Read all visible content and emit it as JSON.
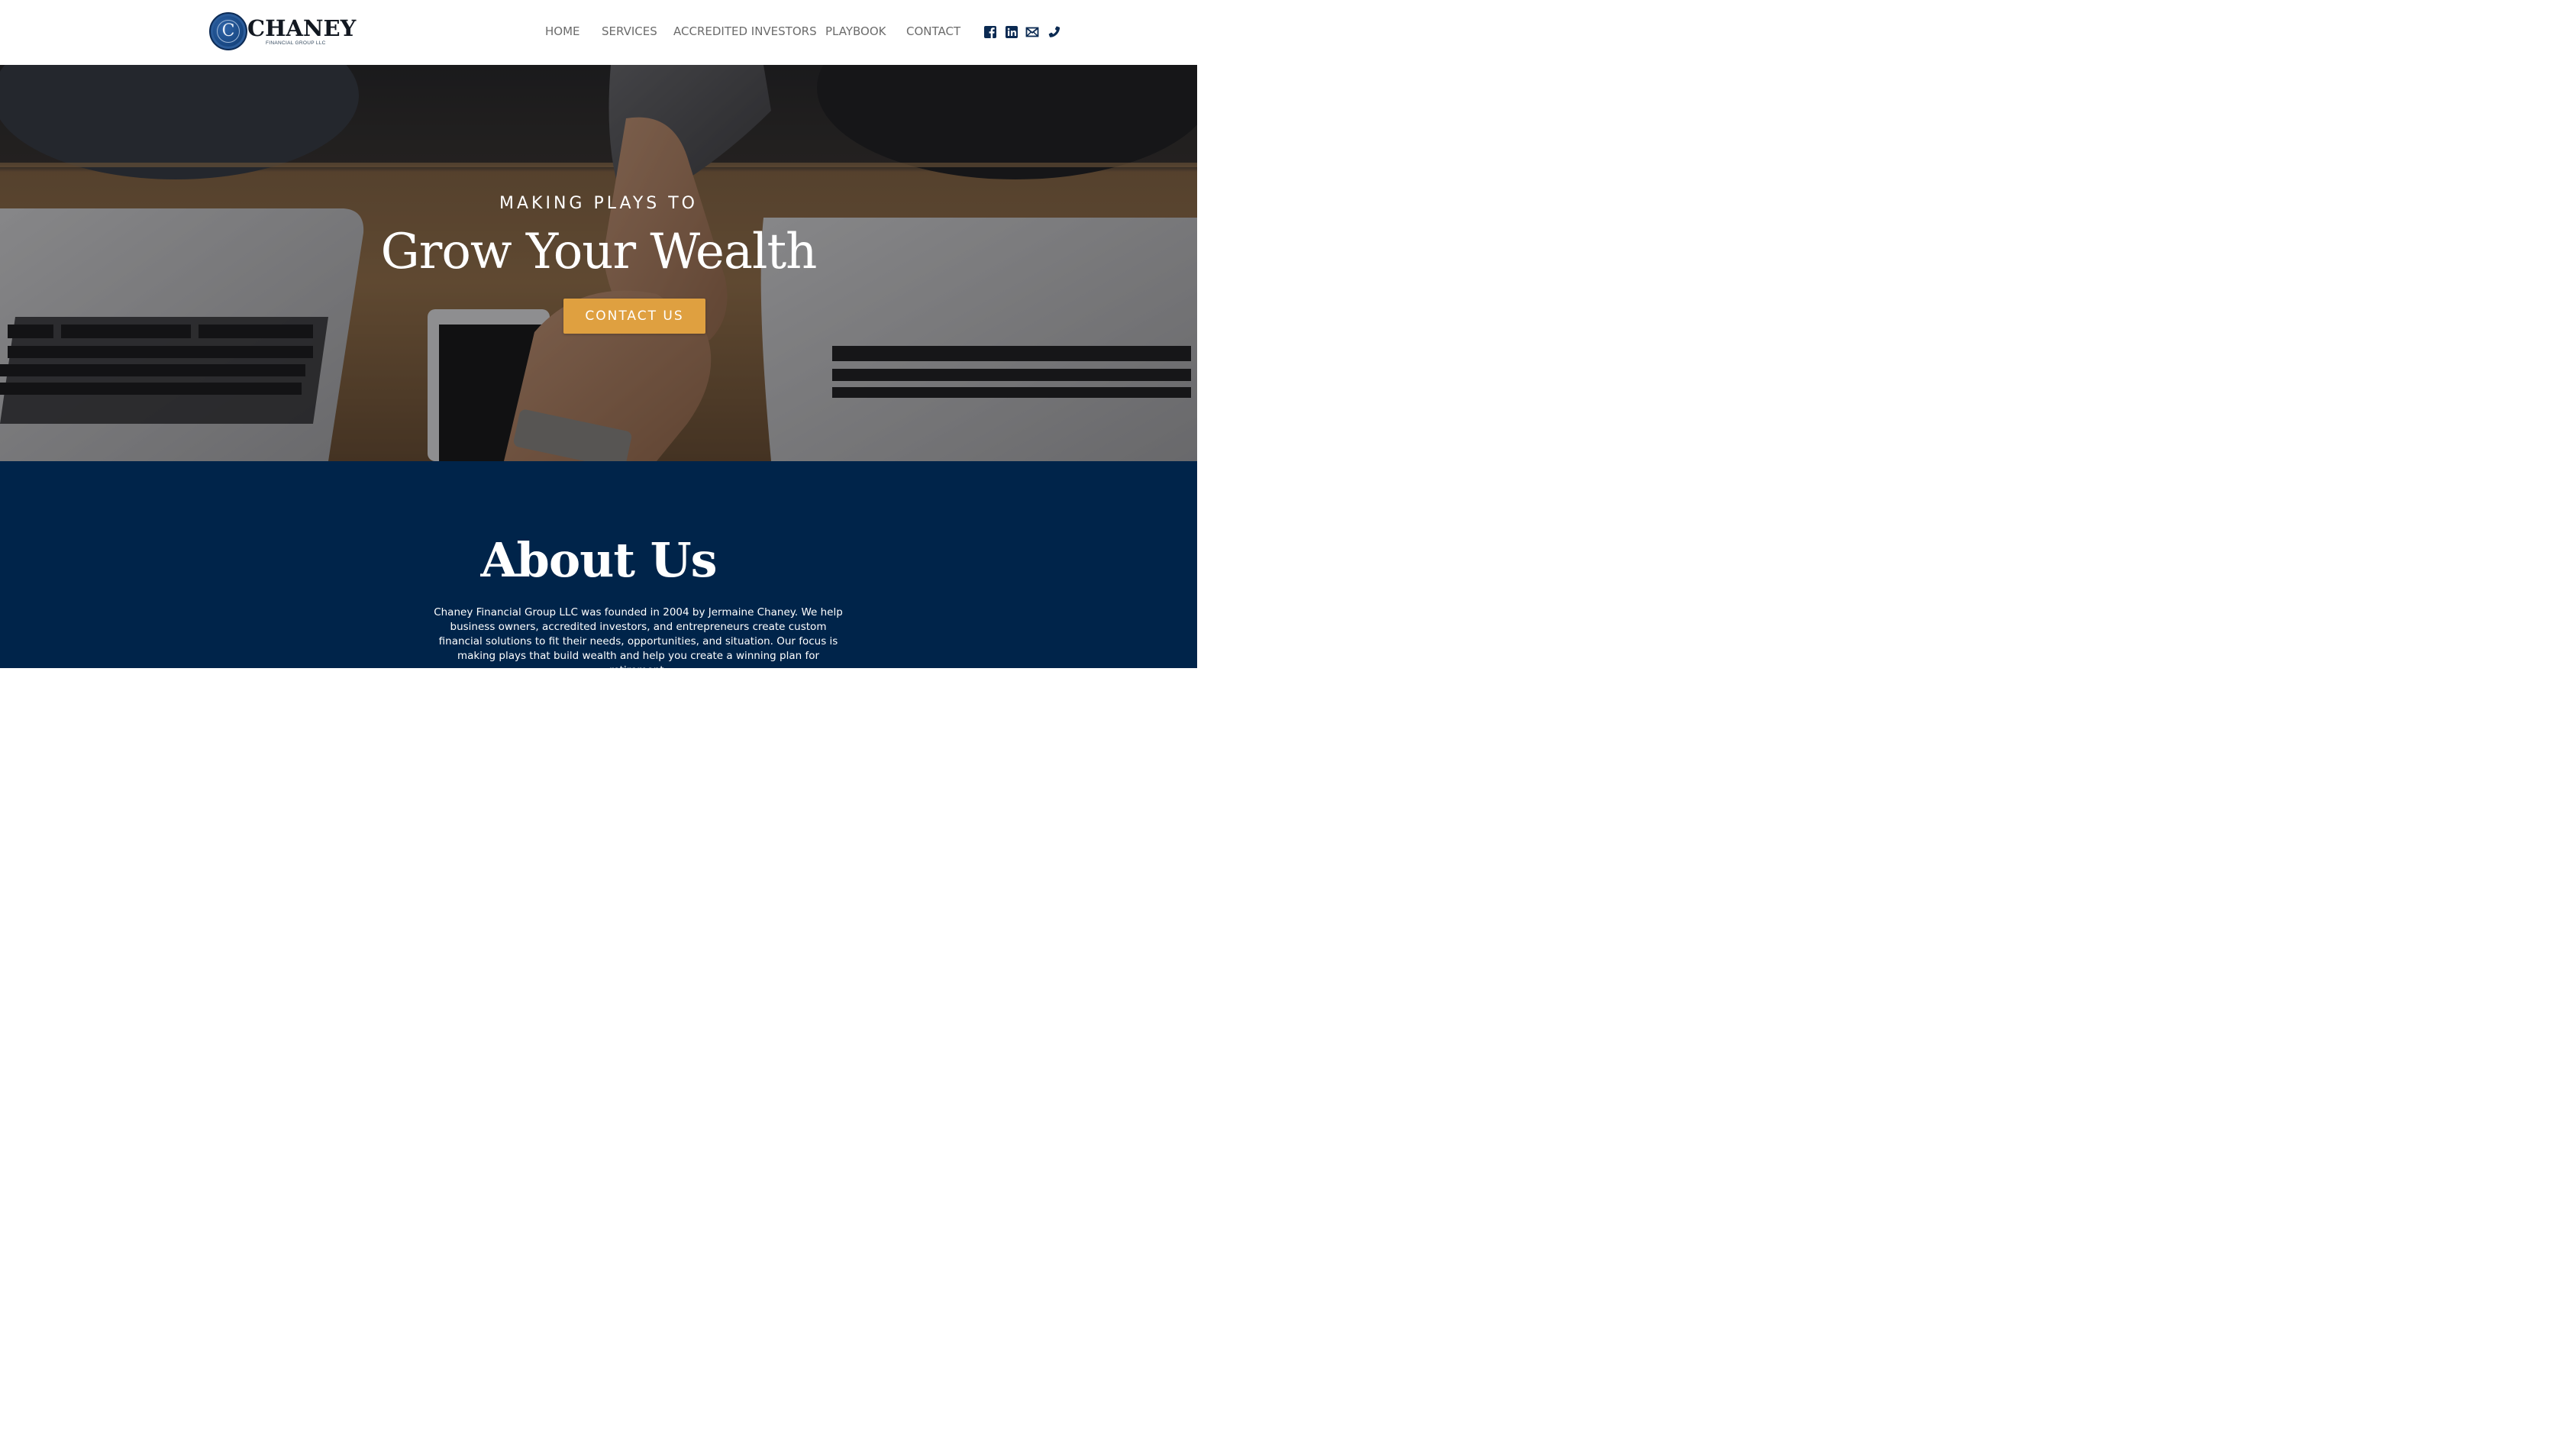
{
  "brand": {
    "seal_letter": "C",
    "name": "CHANEY",
    "subtitle": "FINANCIAL GROUP LLC",
    "color_navy": "#00244a",
    "color_gold": "#dfa040"
  },
  "nav": {
    "items": [
      {
        "label": "HOME"
      },
      {
        "label": "SERVICES"
      },
      {
        "label": "ACCREDITED INVESTORS"
      },
      {
        "label": "PLAYBOOK"
      },
      {
        "label": "CONTACT"
      }
    ],
    "social_icons": [
      "facebook-icon",
      "linkedin-icon",
      "mail-icon",
      "phone-icon"
    ]
  },
  "hero": {
    "kicker": "MAKING PLAYS TO",
    "title": "Grow Your Wealth",
    "button_label": "CONTACT US"
  },
  "about": {
    "title": "About Us",
    "body": "Chaney Financial Group LLC was founded in 2004 by Jermaine Chaney. We help business owners, accredited investors, and entrepreneurs create custom financial solutions to fit their needs, opportunities, and situation. Our focus is making plays that build wealth and help you create a winning plan for retirement."
  }
}
